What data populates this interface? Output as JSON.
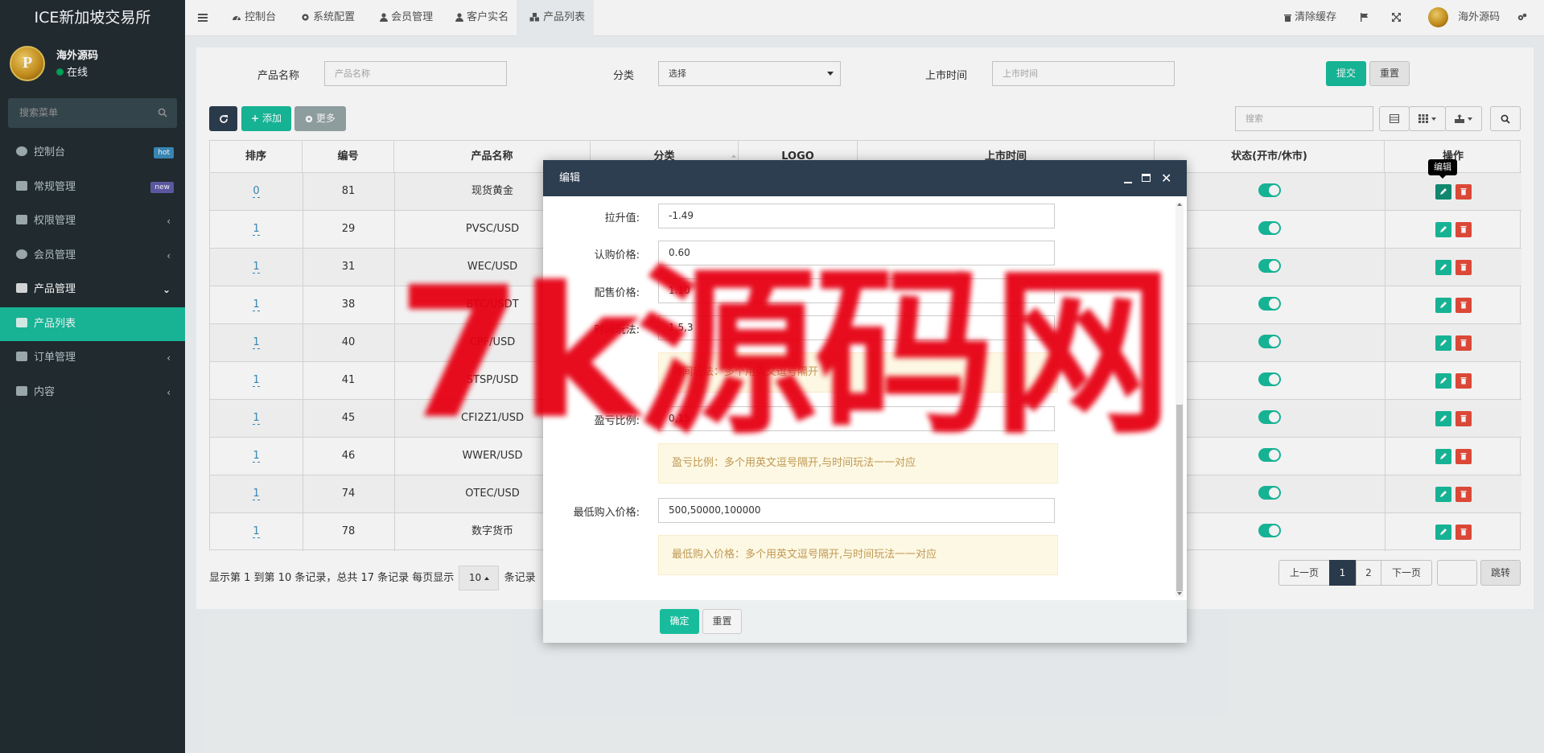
{
  "sidebar": {
    "brand": "ICE新加坡交易所",
    "user": {
      "name": "海外源码",
      "status": "在线",
      "avatar_letter": "P"
    },
    "search_placeholder": "搜索菜单",
    "items": [
      {
        "label": "控制台",
        "badge": "hot",
        "badge_color": "#3c8dbc",
        "icon": "dashboard-icon"
      },
      {
        "label": "常规管理",
        "badge": "new",
        "badge_color": "#605ca8",
        "icon": "cogs-icon"
      },
      {
        "label": "权限管理",
        "chevron": "‹",
        "icon": "group-icon"
      },
      {
        "label": "会员管理",
        "chevron": "‹",
        "icon": "user-circle-icon"
      },
      {
        "label": "产品管理",
        "chevron": "⌄",
        "icon": "product-icon"
      },
      {
        "label": "产品列表",
        "icon": "cubes-icon"
      },
      {
        "label": "订单管理",
        "chevron": "‹",
        "icon": "list-icon"
      },
      {
        "label": "内容",
        "chevron": "‹",
        "icon": "list-icon"
      }
    ]
  },
  "header": {
    "tabs": [
      "控制台",
      "系统配置",
      "会员管理",
      "客户实名",
      "产品列表"
    ],
    "clear_cache": "清除缓存",
    "user_name": "海外源码"
  },
  "search_form": {
    "name_label": "产品名称",
    "name_placeholder": "产品名称",
    "category_label": "分类",
    "category_value": "选择",
    "date_label": "上市时间",
    "date_placeholder": "上市时间",
    "submit": "提交",
    "reset": "重置"
  },
  "toolbar": {
    "add": "添加",
    "more": "更多",
    "search_placeholder": "搜索"
  },
  "table": {
    "headers": [
      "排序",
      "编号",
      "产品名称",
      "分类",
      "LOGO",
      "上市时间",
      "状态(开市/休市)",
      "操作"
    ],
    "rows": [
      {
        "sort": "0",
        "id": "81",
        "name": "现货黄金"
      },
      {
        "sort": "1",
        "id": "29",
        "name": "PVSC/USD"
      },
      {
        "sort": "1",
        "id": "31",
        "name": "WEC/USD"
      },
      {
        "sort": "1",
        "id": "38",
        "name": "BTC/USDT"
      },
      {
        "sort": "1",
        "id": "40",
        "name": "CPF/USD"
      },
      {
        "sort": "1",
        "id": "41",
        "name": "STSP/USD"
      },
      {
        "sort": "1",
        "id": "45",
        "name": "CFI2Z1/USD"
      },
      {
        "sort": "1",
        "id": "46",
        "name": "WWER/USD"
      },
      {
        "sort": "1",
        "id": "74",
        "name": "OTEC/USD"
      },
      {
        "sort": "1",
        "id": "78",
        "name": "数字货币"
      }
    ],
    "status_on": true
  },
  "pagination": {
    "summary_prefix": "显示第 1 到第 10 条记录，总共 17 条记录 每页显示",
    "page_size": "10",
    "summary_suffix": "条记录",
    "prev": "上一页",
    "pages": [
      "1",
      "2"
    ],
    "current": "1",
    "next": "下一页",
    "jump": "跳转"
  },
  "tooltip": "编辑",
  "modal": {
    "title": "编辑",
    "fields": [
      {
        "label": "拉升值:",
        "value": "-1.49"
      },
      {
        "label": "认购价格:",
        "value": "0.60"
      },
      {
        "label": "配售价格:",
        "value": "1.10"
      },
      {
        "label": "时间玩法:",
        "value": "1,5,3"
      },
      {
        "label": "盈亏比例:",
        "value": "0,15"
      },
      {
        "label": "最低购入价格:",
        "value": "500,50000,100000"
      }
    ],
    "tips": [
      "时间玩法：多个用英文逗号隔开",
      "盈亏比例：多个用英文逗号隔开,与时间玩法一一对应",
      "最低购入价格：多个用英文逗号隔开,与时间玩法一一对应"
    ],
    "confirm": "确定",
    "reset": "重置"
  },
  "watermark": "7k源码网"
}
